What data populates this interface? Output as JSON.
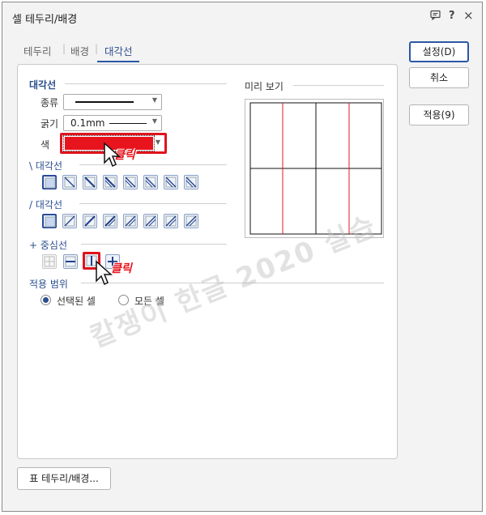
{
  "window": {
    "title": "셀 테두리/배경",
    "icons": {
      "help_tip": "message-icon",
      "help": "?",
      "close": "×"
    }
  },
  "tabs": [
    {
      "label": "테두리",
      "active": false
    },
    {
      "label": "배경",
      "active": false
    },
    {
      "label": "대각선",
      "active": true
    }
  ],
  "diagonal": {
    "section_title": "대각선",
    "type_label": "종류",
    "width_label": "굵기",
    "width_value": "0.1mm",
    "color_label": "색",
    "color_value": "#e8141d",
    "backslash_title": "\\ 대각선",
    "slash_title": "/ 대각선",
    "center_title": "+ 중심선"
  },
  "preview": {
    "label": "미리 보기"
  },
  "apply_range": {
    "title": "적용 범위",
    "options": [
      {
        "label": "선택된 셀",
        "checked": true
      },
      {
        "label": "모든 셀",
        "checked": false
      }
    ]
  },
  "buttons": {
    "ok": "설정(D)",
    "cancel": "취소",
    "apply": "적용(9)",
    "table_border": "표 테두리/배경..."
  },
  "annotations": {
    "click1": "클릭",
    "click2": "클릭"
  },
  "watermark": "칼쟁이 한글 2020 실습"
}
